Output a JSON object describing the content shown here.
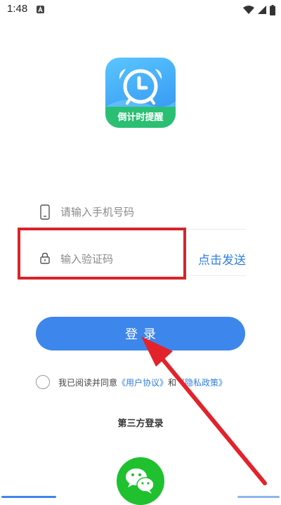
{
  "status_bar": {
    "time": "1:48",
    "notification_icon": "a-square-icon",
    "icons": [
      "wifi-icon",
      "signal-icon",
      "battery-icon"
    ]
  },
  "app": {
    "logo_label": "倒计时提醒",
    "logo_icon": "alarm-clock-icon"
  },
  "form": {
    "phone_placeholder": "请输入手机号码",
    "phone_value": "",
    "code_placeholder": "输入验证码",
    "code_value": "",
    "send_code_label": "点击发送",
    "login_label": "登录"
  },
  "agreement": {
    "prefix": "我已阅读并同意",
    "user_agreement": "《用户协议》",
    "conjunction": "和",
    "privacy_policy": "《隐私政策》",
    "checked": false
  },
  "third_party": {
    "title": "第三方登录",
    "wechat_icon": "wechat-icon"
  },
  "colors": {
    "accent": "#3d86ec",
    "link": "#2f7de1",
    "annotation": "#d8232a",
    "wechat": "#1fc12e",
    "logo_banner": "#2bbf73"
  }
}
